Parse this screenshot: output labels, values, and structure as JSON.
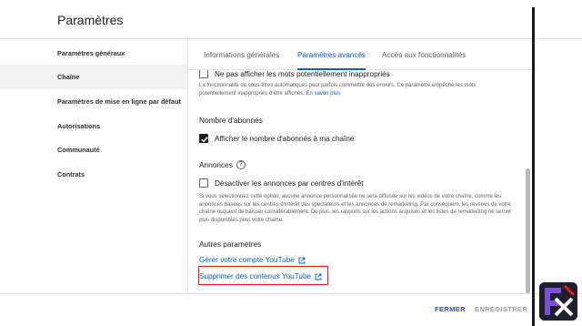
{
  "page": {
    "title": "Paramètres"
  },
  "sidebar": {
    "items": [
      {
        "label": "Paramètres généraux",
        "active": false
      },
      {
        "label": "Chaîne",
        "active": true
      },
      {
        "label": "Paramètres de mise en ligne par défaut",
        "active": false
      },
      {
        "label": "Autorisations",
        "active": false
      },
      {
        "label": "Communauté",
        "active": false
      },
      {
        "label": "Contrats",
        "active": false
      }
    ]
  },
  "tabs": [
    {
      "label": "Informations générales",
      "active": false
    },
    {
      "label": "Paramètres avancés",
      "active": true
    },
    {
      "label": "Accès aux fonctionnalités",
      "active": false
    }
  ],
  "content": {
    "subtitles_checkbox": {
      "label": "Ne pas afficher les mots potentiellement inappropriés",
      "checked": false
    },
    "subtitles_desc": "La fonctionnalité de sous-titres automatiques peut parfois commettre des erreurs. Ce paramètre empêche les mots potentiellement inappropriés d'être affichés.",
    "subtitles_learn_more": "En savoir plus",
    "subscribers": {
      "title": "Nombre d'abonnés",
      "checkbox_label": "Afficher le nombre d'abonnés à ma chaîne",
      "checked": true
    },
    "ads": {
      "title": "Annonces",
      "help_icon": "?",
      "checkbox_label": "Désactiver les annonces par centres d'intérêt",
      "checked": false,
      "description": "Si vous sélectionnez cette option, aucune annonce personnalisée ne sera diffusée sur les vidéos de votre chaîne, comme les annonces basées sur les centres d'intérêt des spectateurs et les annonces de remarketing. Par conséquent, les revenus de votre chaîne risquent de baisser considérablement. De plus, les rapports sur les actions acquises et les listes de remarketing ne seront plus disponibles pour votre chaîne."
    },
    "other": {
      "title": "Autres paramètres",
      "manage_account": "Gérer votre compte YouTube",
      "delete_content": "Supprimer des contenus YouTube"
    }
  },
  "footer": {
    "close": "FERMER",
    "save": "ENREGISTRER"
  },
  "colors": {
    "accent": "#065fd4",
    "highlight": "#e02020",
    "disabled": "#9e9e9e"
  }
}
